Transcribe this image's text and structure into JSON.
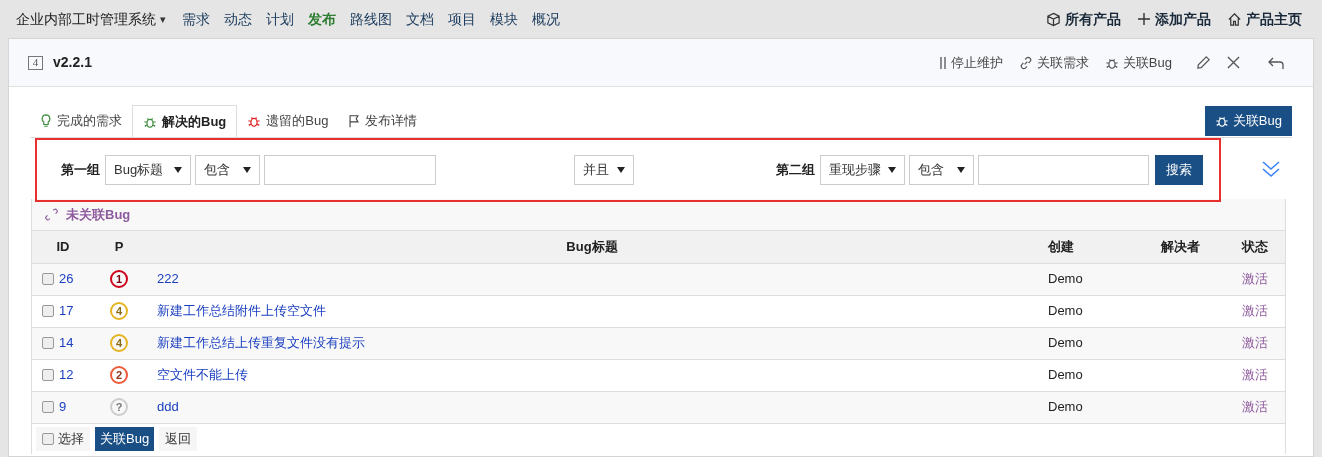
{
  "nav": {
    "app_title": "企业内部工时管理系统",
    "caret": "▾",
    "items": [
      {
        "label": "需求",
        "selected": false
      },
      {
        "label": "动态",
        "selected": false
      },
      {
        "label": "计划",
        "selected": false
      },
      {
        "label": "发布",
        "selected": true
      },
      {
        "label": "路线图",
        "selected": false
      },
      {
        "label": "文档",
        "selected": false
      },
      {
        "label": "项目",
        "selected": false
      },
      {
        "label": "模块",
        "selected": false
      },
      {
        "label": "概况",
        "selected": false
      }
    ],
    "right_links": [
      {
        "kind": "box",
        "label": "所有产品"
      },
      {
        "kind": "plus",
        "label": "添加产品"
      },
      {
        "kind": "home",
        "label": "产品主页"
      }
    ]
  },
  "header": {
    "badge": "4",
    "title": "v2.2.1",
    "actions": [
      {
        "kind": "pause",
        "label": "停止维护"
      },
      {
        "kind": "link",
        "label": "关联需求"
      },
      {
        "kind": "bug",
        "label": "关联Bug"
      }
    ]
  },
  "tabs": [
    {
      "kind": "bulb",
      "label": "完成的需求",
      "selected": false
    },
    {
      "kind": "bug",
      "label": "解决的Bug",
      "selected": true
    },
    {
      "kind": "redbug",
      "label": "遗留的Bug",
      "selected": false
    },
    {
      "kind": "flag",
      "label": "发布详情",
      "selected": false
    }
  ],
  "link_bug_button": "关联Bug",
  "search": {
    "group1": {
      "label": "第一组",
      "field": "Bug标题",
      "operator": "包含"
    },
    "andor": "并且",
    "group2": {
      "label": "第二组",
      "field": "重现步骤",
      "operator": "包含"
    },
    "button": "搜索"
  },
  "unlinked_label": "未关联Bug",
  "table": {
    "columns": [
      "ID",
      "P",
      "Bug标题",
      "创建",
      "解决者",
      "状态"
    ],
    "rows": [
      {
        "id": "26",
        "priority": "1",
        "color": "#d0021b",
        "title": "222",
        "creator": "Demo",
        "status": "激活",
        "checked": false
      },
      {
        "id": "17",
        "priority": "4",
        "color": "#e6b422",
        "title": "新建工作总结附件上传空文件",
        "creator": "Demo",
        "status": "激活",
        "checked": false
      },
      {
        "id": "14",
        "priority": "4",
        "color": "#e6b422",
        "title": "新建工作总结上传重复文件没有提示",
        "creator": "Demo",
        "status": "激活",
        "checked": false
      },
      {
        "id": "12",
        "priority": "2",
        "color": "#f05a3a",
        "title": "空文件不能上传",
        "creator": "Demo",
        "status": "激活",
        "checked": false
      },
      {
        "id": "9",
        "priority": "?",
        "color": "#cccccc",
        "title": "ddd",
        "creator": "Demo",
        "status": "激活",
        "checked": false
      }
    ]
  },
  "footer": {
    "select_all": "选择",
    "select_all_checked": false,
    "link_button": "关联Bug",
    "back_button": "返回"
  }
}
